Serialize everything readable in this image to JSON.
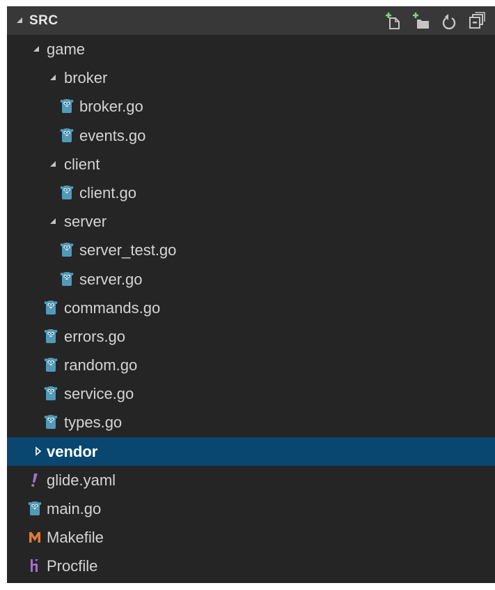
{
  "explorer": {
    "section_title": "SRC",
    "actions": {
      "new_file_icon": "new-file-icon",
      "new_folder_icon": "new-folder-icon",
      "refresh_icon": "refresh-icon",
      "collapse_all_icon": "collapse-all-icon"
    },
    "colors": {
      "background": "#252526",
      "header": "#383838",
      "selection": "#094771",
      "go_icon": "#519aba",
      "yaml_icon": "#a074c4",
      "makefile_icon": "#e37933",
      "procfile_icon": "#a074c4",
      "add_badge": "#89d185"
    },
    "items": [
      {
        "label": "game",
        "type": "folder",
        "expanded": true,
        "depth": 1
      },
      {
        "label": "broker",
        "type": "folder",
        "expanded": true,
        "depth": 2
      },
      {
        "label": "broker.go",
        "type": "go",
        "depth": 3
      },
      {
        "label": "events.go",
        "type": "go",
        "depth": 3
      },
      {
        "label": "client",
        "type": "folder",
        "expanded": true,
        "depth": 2
      },
      {
        "label": "client.go",
        "type": "go",
        "depth": 3
      },
      {
        "label": "server",
        "type": "folder",
        "expanded": true,
        "depth": 2
      },
      {
        "label": "server_test.go",
        "type": "go",
        "depth": 3
      },
      {
        "label": "server.go",
        "type": "go",
        "depth": 3
      },
      {
        "label": "commands.go",
        "type": "go",
        "depth": 2
      },
      {
        "label": "errors.go",
        "type": "go",
        "depth": 2
      },
      {
        "label": "random.go",
        "type": "go",
        "depth": 2
      },
      {
        "label": "service.go",
        "type": "go",
        "depth": 2
      },
      {
        "label": "types.go",
        "type": "go",
        "depth": 2
      },
      {
        "label": "vendor",
        "type": "folder",
        "expanded": false,
        "selected": true,
        "depth": 1
      },
      {
        "label": "glide.yaml",
        "type": "yaml",
        "depth": 1
      },
      {
        "label": "main.go",
        "type": "go",
        "depth": 1
      },
      {
        "label": "Makefile",
        "type": "makefile",
        "depth": 1
      },
      {
        "label": "Procfile",
        "type": "procfile",
        "depth": 1
      }
    ]
  }
}
